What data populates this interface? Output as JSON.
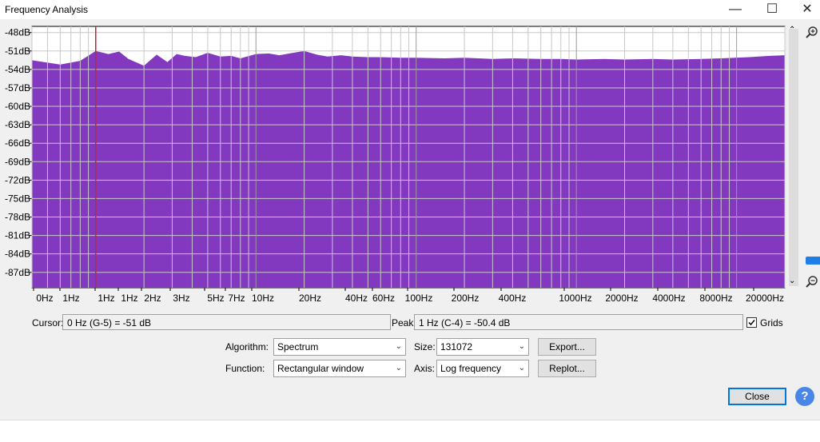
{
  "window": {
    "title": "Frequency Analysis",
    "controls": {
      "minimize": "—",
      "maximize": "☐",
      "close": "✕"
    }
  },
  "chart_data": {
    "type": "area",
    "title": "",
    "xlabel": "",
    "ylabel": "",
    "x_scale": "log",
    "fill_color": "#8338c0",
    "cursor_line_color": "#b03030",
    "grid": true,
    "ylim": [
      -89.5,
      -47
    ],
    "y_ticks": [
      "-48dB",
      "-51dB",
      "-54dB",
      "-57dB",
      "-60dB",
      "-63dB",
      "-66dB",
      "-69dB",
      "-72dB",
      "-75dB",
      "-78dB",
      "-81dB",
      "-84dB",
      "-87dB"
    ],
    "x_ticks": [
      "0Hz",
      "1Hz",
      "1Hz",
      "1Hz",
      "2Hz",
      "3Hz",
      "5Hz",
      "7Hz",
      "10Hz",
      "20Hz",
      "40Hz",
      "60Hz",
      "100Hz",
      "200Hz",
      "400Hz",
      "1000Hz",
      "2000Hz",
      "4000Hz",
      "8000Hz",
      "20000Hz"
    ],
    "x": [
      0.4,
      0.6,
      0.8,
      1.0,
      1.2,
      1.4,
      1.6,
      2.0,
      2.4,
      2.8,
      3.2,
      3.6,
      4.2,
      5.0,
      6.0,
      7.0,
      8.0,
      10,
      12,
      14,
      17,
      20,
      24,
      28,
      34,
      40,
      50,
      60,
      80,
      100,
      150,
      200,
      300,
      400,
      600,
      800,
      1000,
      1500,
      2000,
      3000,
      4000,
      6000,
      8000,
      12000,
      16000,
      20000
    ],
    "values": [
      -52.5,
      -53.2,
      -52.6,
      -51.0,
      -51.5,
      -51.1,
      -52.3,
      -53.4,
      -51.6,
      -52.8,
      -51.5,
      -51.8,
      -52.0,
      -51.3,
      -51.9,
      -51.8,
      -52.2,
      -51.5,
      -51.4,
      -51.7,
      -51.3,
      -51.0,
      -51.6,
      -51.9,
      -51.7,
      -51.9,
      -52.0,
      -52.0,
      -52.1,
      -52.1,
      -52.2,
      -52.1,
      -52.3,
      -52.2,
      -52.3,
      -52.3,
      -52.4,
      -52.3,
      -52.4,
      -52.3,
      -52.4,
      -52.3,
      -52.2,
      -52.0,
      -51.8,
      -51.7
    ],
    "cursor_x": 1.0
  },
  "info": {
    "cursor_label": "Cursor:",
    "cursor_value": "0 Hz (G-5) = -51 dB",
    "peak_label": "Peak:",
    "peak_value": "1 Hz (C-4) = -50.4 dB",
    "grids_label": "Grids",
    "grids_checked": true
  },
  "controls": {
    "algorithm_label": "Algorithm:",
    "algorithm_value": "Spectrum",
    "size_label": "Size:",
    "size_value": "131072",
    "export_label": "Export...",
    "function_label": "Function:",
    "function_value": "Rectangular window",
    "axis_label": "Axis:",
    "axis_value": "Log frequency",
    "replot_label": "Replot..."
  },
  "footer": {
    "close_label": "Close",
    "help_label": "?"
  },
  "zoom": {
    "zoom_in_icon": "magnifier-plus",
    "zoom_out_icon": "magnifier-minus"
  }
}
